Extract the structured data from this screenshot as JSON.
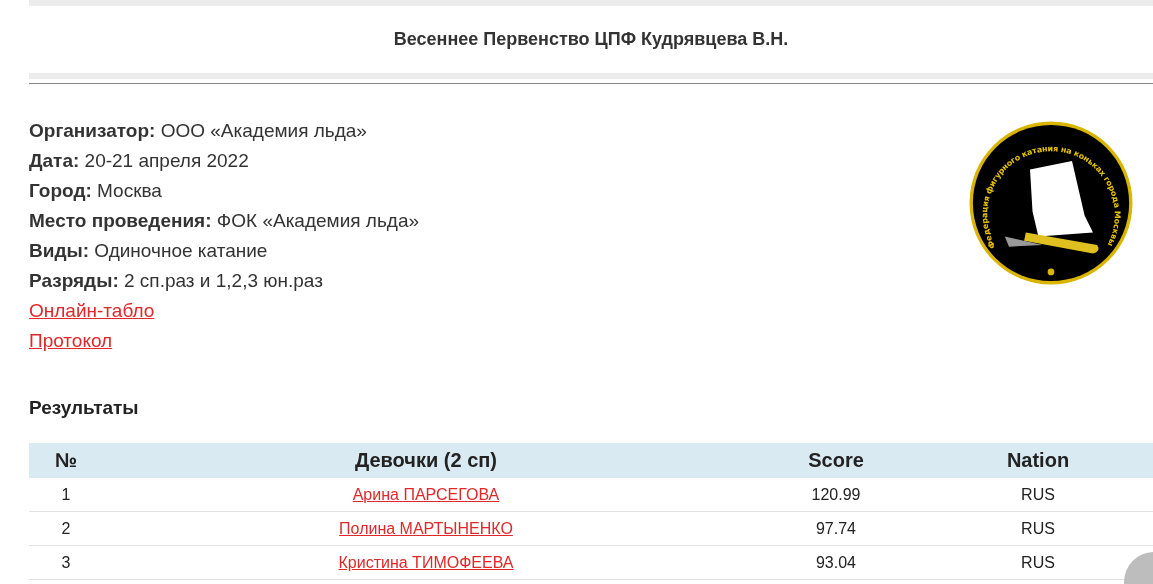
{
  "header": {
    "title": "Весеннее Первенство ЦПФ Кудрявцева В.Н."
  },
  "info": [
    {
      "label": "Организатор:",
      "value": "ООО «Академия льда»"
    },
    {
      "label": "Дата:",
      "value": "20-21 апреля 2022"
    },
    {
      "label": "Город:",
      "value": "Москва"
    },
    {
      "label": "Место проведения:",
      "value": "ФОК «Академия льда»"
    },
    {
      "label": "Виды:",
      "value": "Одиночное катание"
    },
    {
      "label": "Разряды:",
      "value": "2 сп.раз и 1,2,3 юн.раз"
    }
  ],
  "links": [
    "Онлайн-табло",
    "Протокол"
  ],
  "logo": {
    "text": "Федерация фигурного катания на коньках города Москвы"
  },
  "results": {
    "title": "Результаты",
    "columns": [
      "№",
      "Девочки (2 сп)",
      "Score",
      "Nation"
    ],
    "rows": [
      {
        "place": "1",
        "name": "Арина ПАРСЕГОВА",
        "score": "120.99",
        "nation": "RUS"
      },
      {
        "place": "2",
        "name": "Полина МАРТЫНЕНКО",
        "score": "97.74",
        "nation": "RUS"
      },
      {
        "place": "3",
        "name": "Кристина ТИМОФЕЕВА",
        "score": "93.04",
        "nation": "RUS"
      }
    ]
  }
}
